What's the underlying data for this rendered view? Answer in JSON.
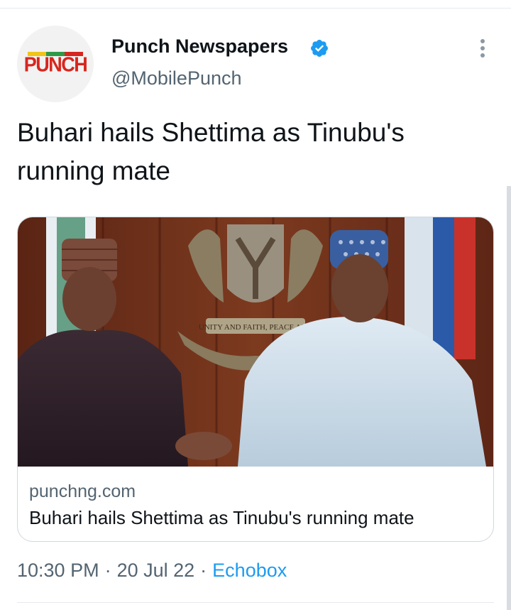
{
  "author": {
    "name": "Punch Newspapers",
    "handle": "@MobilePunch",
    "verified": true,
    "avatar_logo_text": "PUNCH",
    "avatar_logo_colors": [
      "#f0c419",
      "#2e9a47",
      "#d7261e"
    ]
  },
  "tweet": {
    "text": "Buhari hails Shettima as Tinubu's running mate"
  },
  "link_card": {
    "domain": "punchng.com",
    "title": "Buhari hails Shettima as Tinubu's running mate",
    "image_alt_subject": "two-men-handshake-photo"
  },
  "meta": {
    "time": "10:30 PM",
    "date": "20 Jul 22",
    "separator": "·",
    "source": "Echobox"
  },
  "colors": {
    "text_primary": "#0f1419",
    "text_secondary": "#536471",
    "accent": "#1d9bf0",
    "border": "#cfd9de",
    "brand_red": "#d7261e"
  },
  "icons": {
    "verified": "verified-badge-icon",
    "more": "more-options-icon"
  }
}
